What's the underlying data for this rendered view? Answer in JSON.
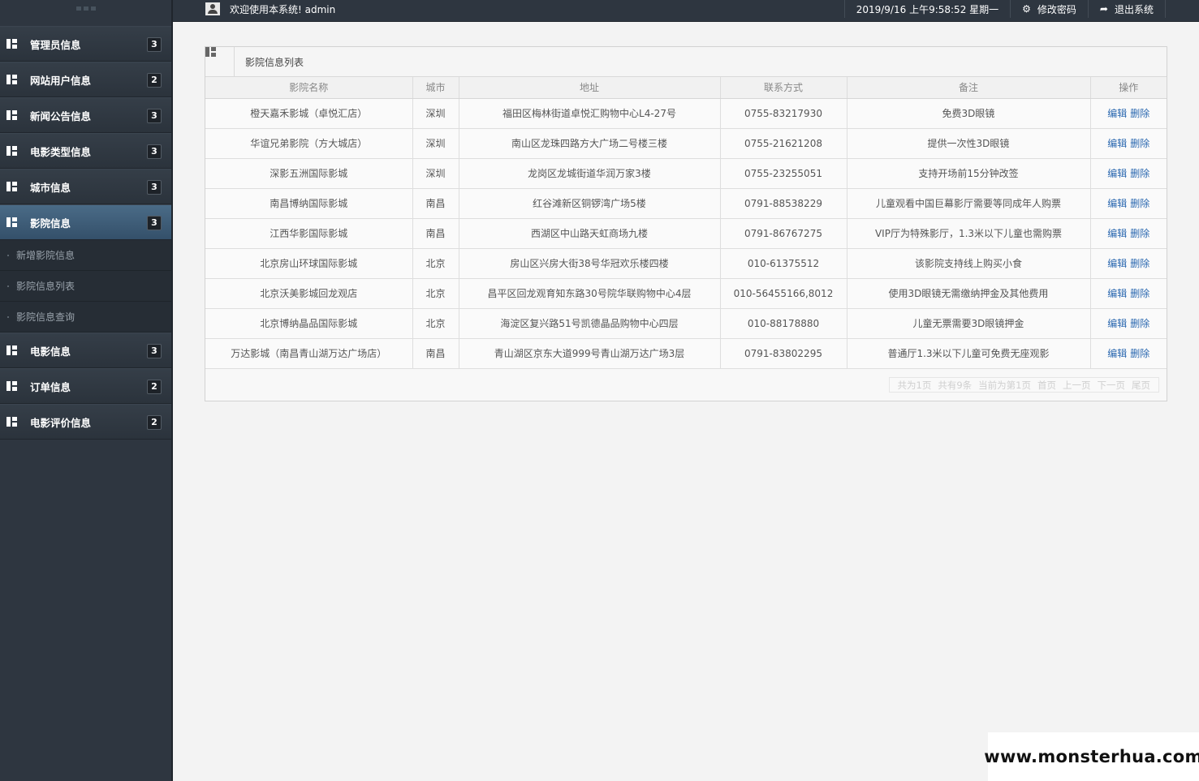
{
  "sidebar": {
    "items": [
      {
        "label": "管理员信息",
        "badge": "3",
        "active": false
      },
      {
        "label": "网站用户信息",
        "badge": "2",
        "active": false
      },
      {
        "label": "新闻公告信息",
        "badge": "3",
        "active": false
      },
      {
        "label": "电影类型信息",
        "badge": "3",
        "active": false
      },
      {
        "label": "城市信息",
        "badge": "3",
        "active": false
      },
      {
        "label": "影院信息",
        "badge": "3",
        "active": true
      }
    ],
    "sub_items": [
      "新增影院信息",
      "影院信息列表",
      "影院信息查询"
    ],
    "items_after": [
      {
        "label": "电影信息",
        "badge": "3"
      },
      {
        "label": "订单信息",
        "badge": "2"
      },
      {
        "label": "电影评价信息",
        "badge": "2"
      }
    ]
  },
  "topbar": {
    "welcome": "欢迎使用本系统! admin",
    "datetime": "2019/9/16 上午9:58:52 星期一",
    "change_password": "修改密码",
    "logout": "退出系统"
  },
  "panel": {
    "title": "影院信息列表",
    "columns": [
      "影院名称",
      "城市",
      "地址",
      "联系方式",
      "备注",
      "操作"
    ],
    "rows": [
      [
        "橙天嘉禾影城（卓悦汇店）",
        "深圳",
        "福田区梅林街道卓悦汇购物中心L4-27号",
        "0755-83217930",
        "免费3D眼镜"
      ],
      [
        "华谊兄弟影院（方大城店）",
        "深圳",
        "南山区龙珠四路方大广场二号楼三楼",
        "0755-21621208",
        "提供一次性3D眼镜"
      ],
      [
        "深影五洲国际影城",
        "深圳",
        "龙岗区龙城街道华润万家3楼",
        "0755-23255051",
        "支持开场前15分钟改签"
      ],
      [
        "南昌博纳国际影城",
        "南昌",
        "红谷滩新区铜锣湾广场5楼",
        "0791-88538229",
        "儿童观看中国巨幕影厅需要等同成年人购票"
      ],
      [
        "江西华影国际影城",
        "南昌",
        "西湖区中山路天虹商场九楼",
        "0791-86767275",
        "VIP厅为特殊影厅，1.3米以下儿童也需购票"
      ],
      [
        "北京房山环球国际影城",
        "北京",
        "房山区兴房大街38号华冠欢乐楼四楼",
        "010-61375512",
        "该影院支持线上购买小食"
      ],
      [
        "北京沃美影城回龙观店",
        "北京",
        "昌平区回龙观育知东路30号院华联购物中心4层",
        "010-56455166,8012",
        "使用3D眼镜无需缴纳押金及其他费用"
      ],
      [
        "北京博纳晶品国际影城",
        "北京",
        "海淀区复兴路51号凯德晶品购物中心四层",
        "010-88178880",
        "儿童无票需要3D眼镜押金"
      ],
      [
        "万达影城（南昌青山湖万达广场店）",
        "南昌",
        "青山湖区京东大道999号青山湖万达广场3层",
        "0791-83802295",
        "普通厅1.3米以下儿童可免费无座观影"
      ]
    ],
    "actions": {
      "edit": "编辑",
      "delete": "删除"
    },
    "pager": [
      "共为1页",
      "共有9条",
      "当前为第1页",
      "首页",
      "上一页",
      "下一页",
      "尾页"
    ]
  },
  "watermark": "www.monsterhua.com"
}
